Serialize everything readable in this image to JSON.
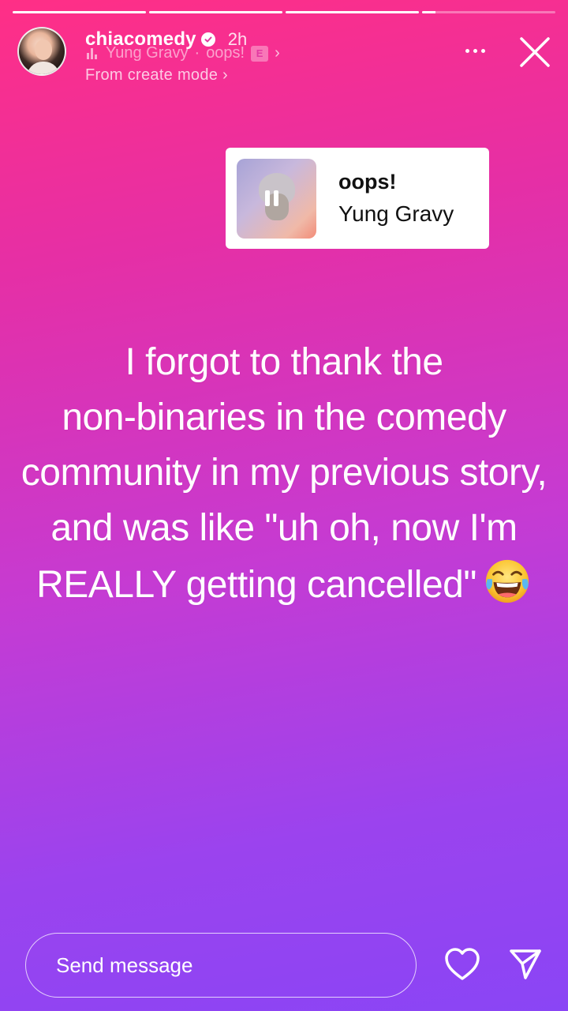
{
  "story": {
    "progress_segments": [
      1,
      1,
      1,
      0.1
    ],
    "user": {
      "username": "chiacomedy",
      "timestamp": "2h",
      "verified": true
    },
    "music": {
      "artist": "Yung Gravy",
      "separator": "·",
      "song": "oops!",
      "explicit_label": "E",
      "chevron": "›"
    },
    "subtitle": "From create mode ›",
    "sticker": {
      "song": "oops!",
      "artist": "Yung Gravy"
    },
    "text_lines": [
      "I forgot to thank the",
      "non-binaries in the comedy",
      "community in my previous story,",
      "and was like \"uh oh, now I'm",
      "REALLY getting cancelled\""
    ],
    "emoji": "face-with-tears-of-joy"
  },
  "footer": {
    "message_placeholder": "Send message"
  },
  "icons": {
    "more": "more-icon",
    "close": "close-icon",
    "like": "heart-icon",
    "share": "send-icon",
    "verified": "verified-badge-icon"
  }
}
